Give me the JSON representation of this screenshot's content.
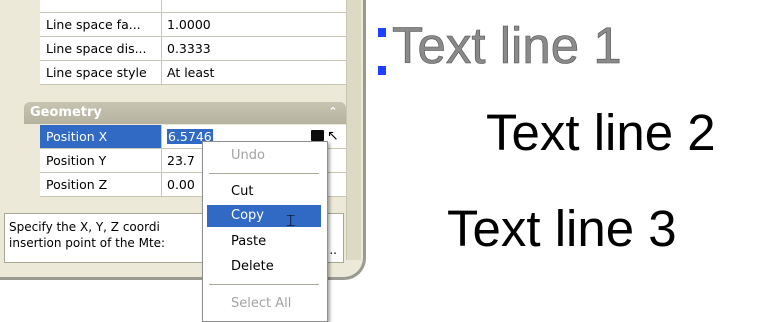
{
  "properties": {
    "text_rows": [
      {
        "name": "",
        "value": ""
      },
      {
        "name": "Line space fa...",
        "value": "1.0000"
      },
      {
        "name": "Line space dis...",
        "value": "0.3333"
      },
      {
        "name": "Line space style",
        "value": "At least"
      }
    ],
    "geometry": {
      "title": "Geometry",
      "rows": [
        {
          "name": "Position X",
          "value": "6.5746"
        },
        {
          "name": "Position Y",
          "value": "23.7"
        },
        {
          "name": "Position Z",
          "value": "0.00"
        }
      ]
    },
    "description_line1": "Specify the X, Y, Z coordi",
    "description_line2": "insertion point of the Mte:",
    "description_more": "..."
  },
  "context_menu": {
    "items": [
      {
        "label": "Undo",
        "enabled": false
      },
      {
        "label": "Cut",
        "enabled": true
      },
      {
        "label": "Copy",
        "enabled": true,
        "highlighted": true
      },
      {
        "label": "Paste",
        "enabled": true
      },
      {
        "label": "Delete",
        "enabled": true
      },
      {
        "label": "Select All",
        "enabled": false
      }
    ]
  },
  "drawing": {
    "line1": "Text line 1",
    "line2": "Text line 2",
    "line3": "Text line 3",
    "grip_color": "#1e40ff"
  },
  "icons": {
    "collapse": "double-chevron-up-icon",
    "calculator": "quick-calc-icon",
    "pick_point": "pick-point-icon",
    "cursor": "text-ibeam-cursor"
  },
  "colors": {
    "selection": "#316ac5",
    "panel": "#ece9d8"
  }
}
